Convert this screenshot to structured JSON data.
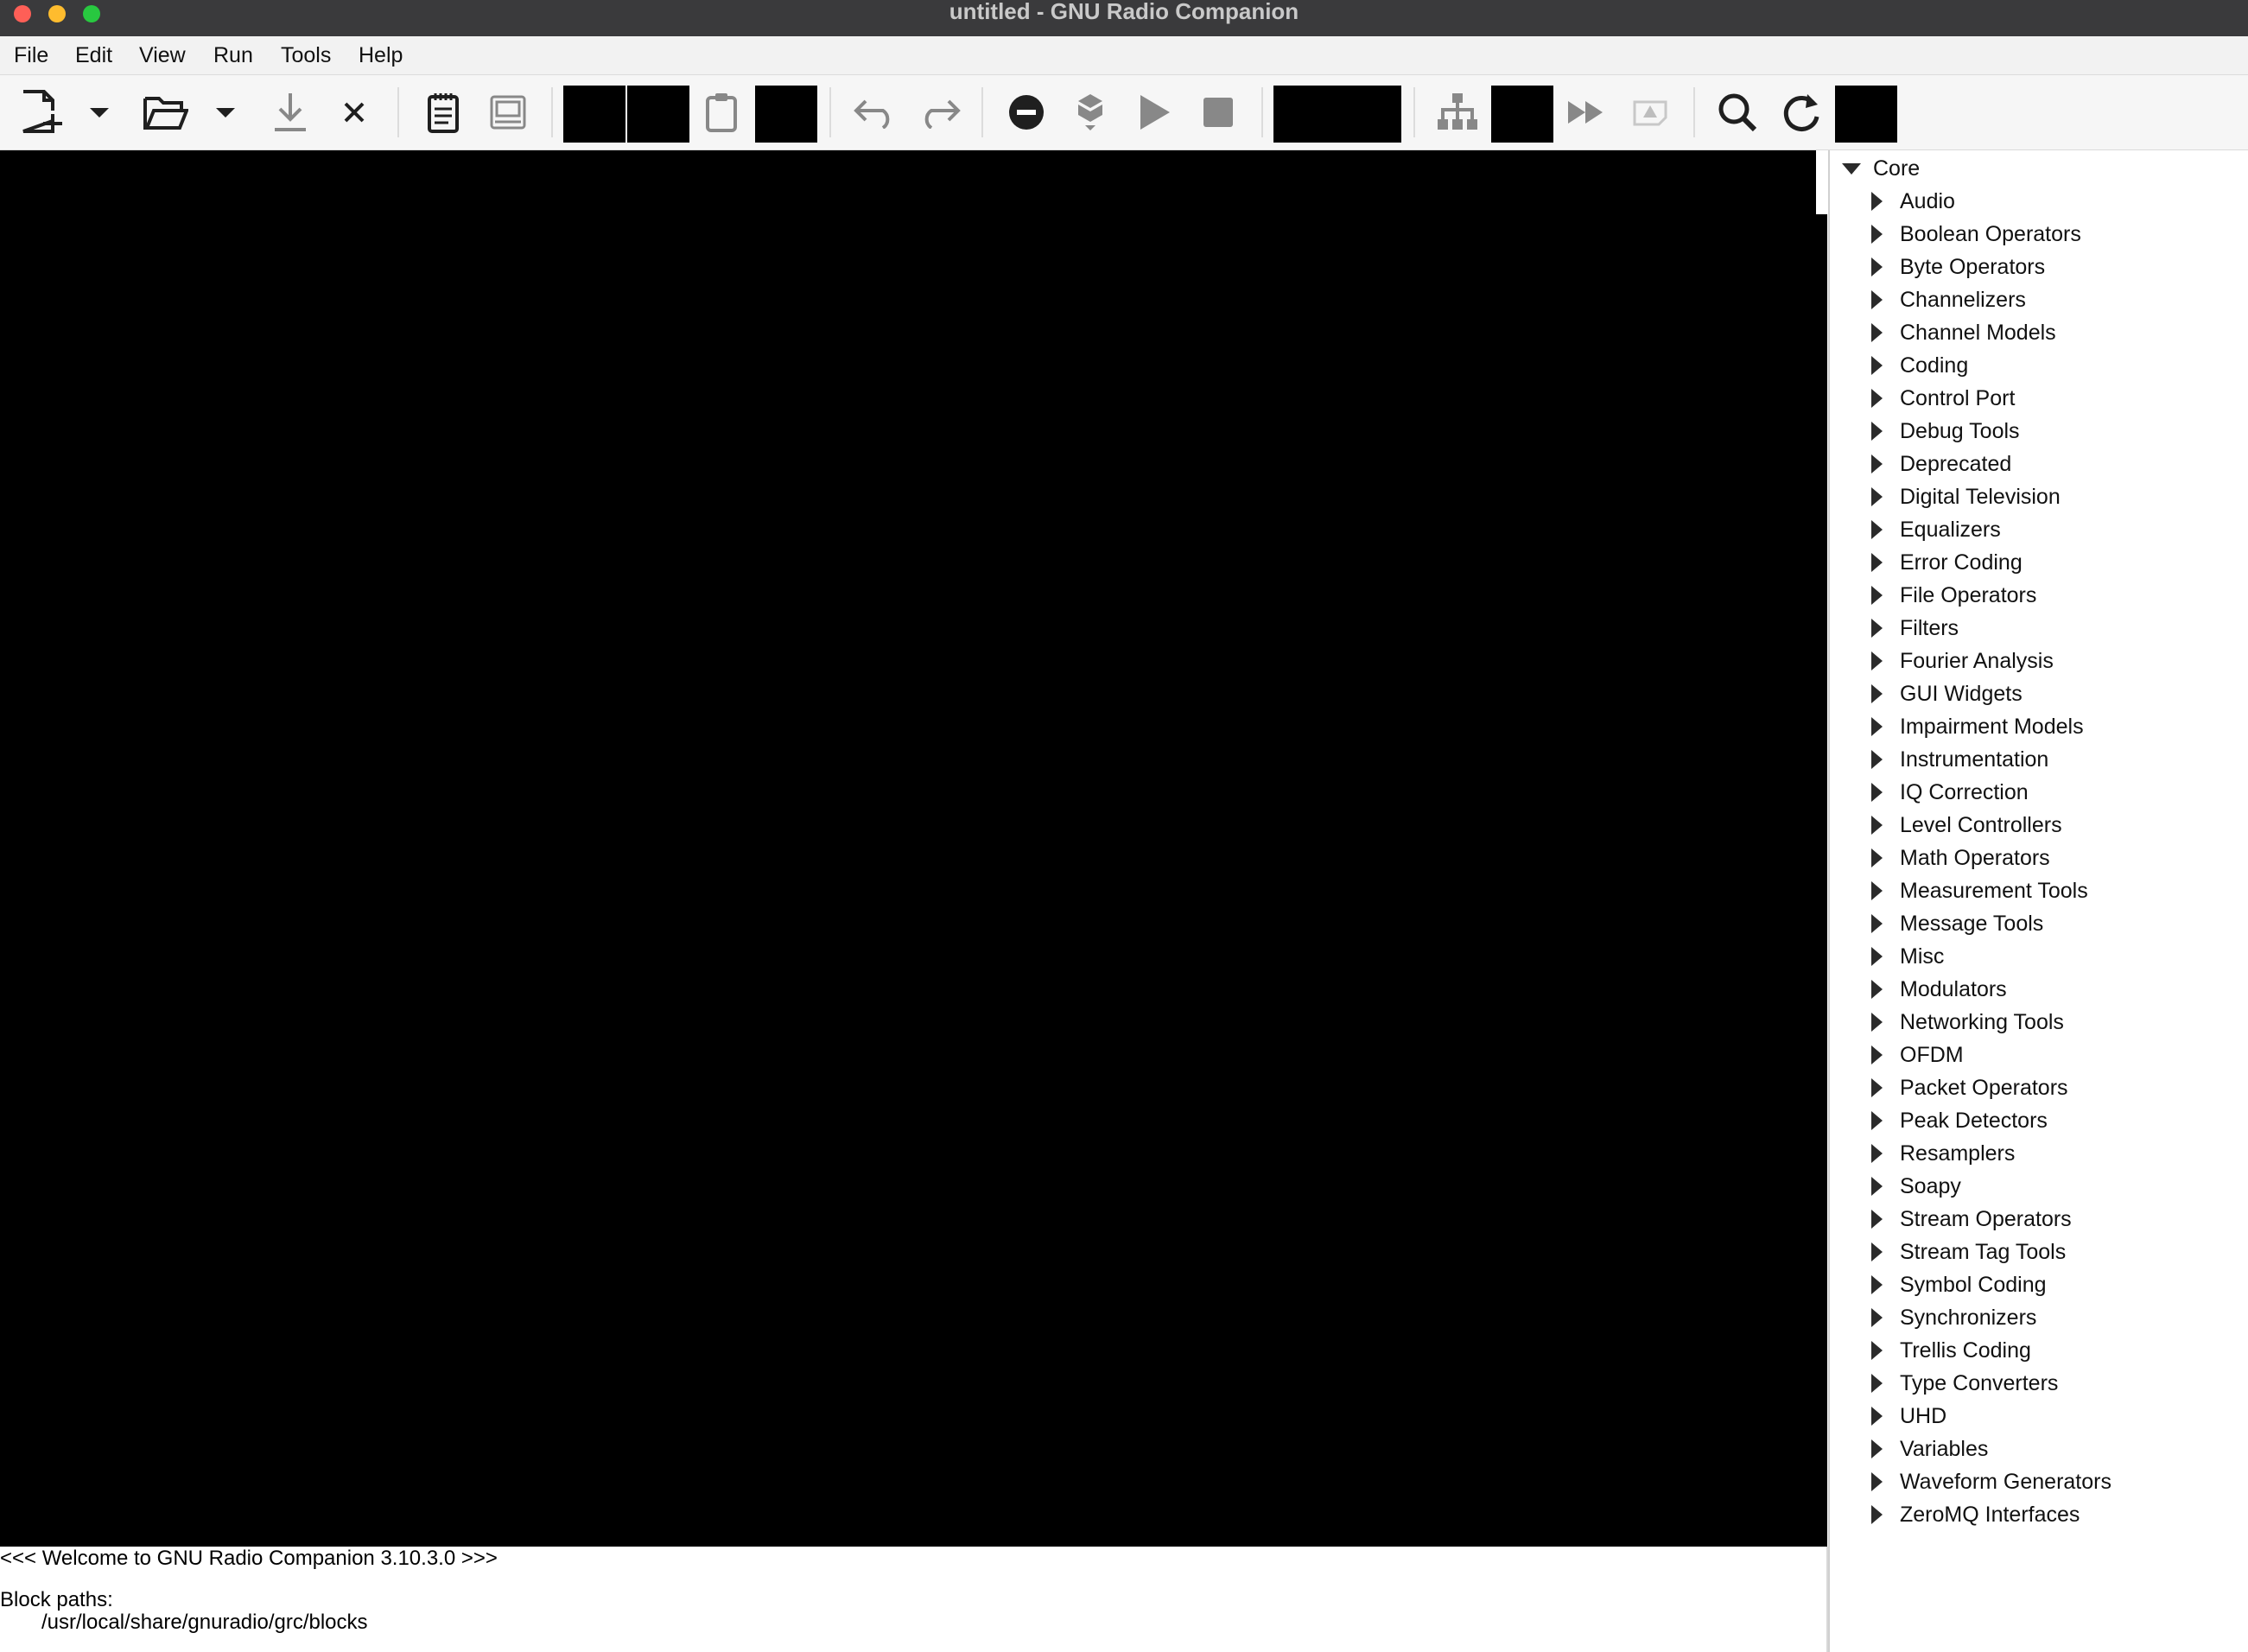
{
  "window": {
    "title": "untitled - GNU Radio Companion"
  },
  "menu": [
    "File",
    "Edit",
    "View",
    "Run",
    "Tools",
    "Help"
  ],
  "toolbar": {
    "icons": [
      "new-flowgraph-icon",
      "chevron-down-icon",
      "open-folder-icon",
      "chevron-down-icon",
      "save-icon",
      "close-icon",
      "report-icon",
      "screen-capture-icon",
      "cut-icon",
      "copy-icon",
      "paste-icon",
      "delete-icon",
      "undo-icon",
      "redo-icon",
      "disable-block-icon",
      "bypass-block-icon",
      "execute-icon",
      "stop-icon",
      "rotate-icon",
      "hierarchy-icon",
      "create-hier-icon",
      "forward-icon",
      "error-icon",
      "search-icon",
      "reload-icon",
      "extra-icon"
    ]
  },
  "console": {
    "welcome": "<<< Welcome to GNU Radio Companion 3.10.3.0 >>>",
    "block_paths_label": "Block paths:",
    "block_path": "/usr/local/share/gnuradio/grc/blocks"
  },
  "sidebar": {
    "root": "Core",
    "categories": [
      "Audio",
      "Boolean Operators",
      "Byte Operators",
      "Channelizers",
      "Channel Models",
      "Coding",
      "Control Port",
      "Debug Tools",
      "Deprecated",
      "Digital Television",
      "Equalizers",
      "Error Coding",
      "File Operators",
      "Filters",
      "Fourier Analysis",
      "GUI Widgets",
      "Impairment Models",
      "Instrumentation",
      "IQ Correction",
      "Level Controllers",
      "Math Operators",
      "Measurement Tools",
      "Message Tools",
      "Misc",
      "Modulators",
      "Networking Tools",
      "OFDM",
      "Packet Operators",
      "Peak Detectors",
      "Resamplers",
      "Soapy",
      "Stream Operators",
      "Stream Tag Tools",
      "Symbol Coding",
      "Synchronizers",
      "Trellis Coding",
      "Type Converters",
      "UHD",
      "Variables",
      "Waveform Generators",
      "ZeroMQ Interfaces"
    ]
  },
  "colors": {
    "titlebar": "#3a3a3c",
    "canvas": "#000000",
    "icon_gray": "#888888",
    "icon_dark": "#1f1f1f"
  }
}
